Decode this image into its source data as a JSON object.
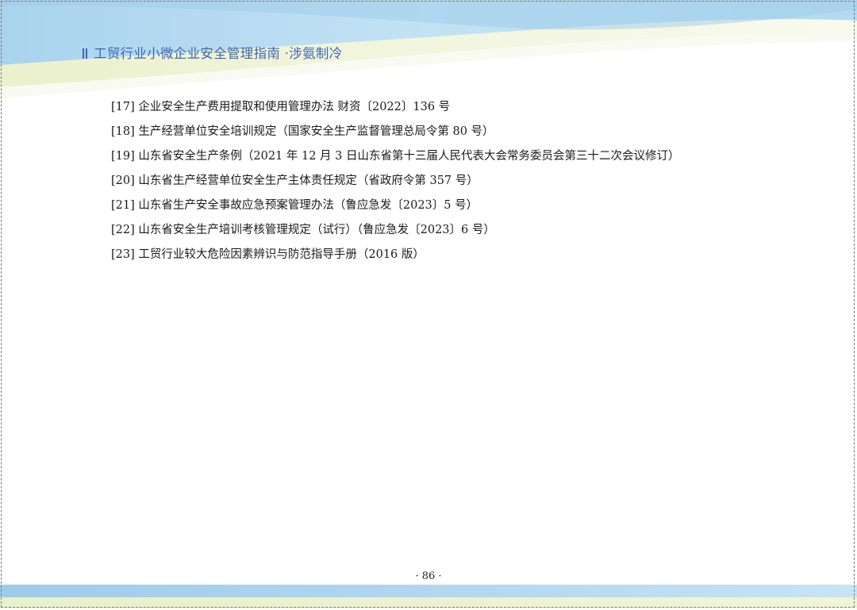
{
  "header": {
    "title": "工贸行业小微企业安全管理指南 ·涉氨制冷"
  },
  "references": [
    "[17] 企业安全生产费用提取和使用管理办法 财资〔2022〕136 号",
    "[18] 生产经营单位安全培训规定（国家安全生产监督管理总局令第 80 号）",
    "[19] 山东省安全生产条例（2021 年 12 月 3 日山东省第十三届人民代表大会常务委员会第三十二次会议修订）",
    "[20] 山东省生产经营单位安全生产主体责任规定（省政府令第 357 号）",
    "[21] 山东省生产安全事故应急预案管理办法（鲁应急发〔2023〕5 号）",
    "[22] 山东省安全生产培训考核管理规定（试行）（鲁应急发〔2023〕6 号）",
    "[23] 工贸行业较大危险因素辨识与防范指导手册（2016 版）"
  ],
  "footer": {
    "page_number": "· 86 ·"
  },
  "colors": {
    "accent": "#3d66b5",
    "wave_light_blue": "#bfe0f3",
    "wave_yellow_green": "#eef3cc"
  }
}
